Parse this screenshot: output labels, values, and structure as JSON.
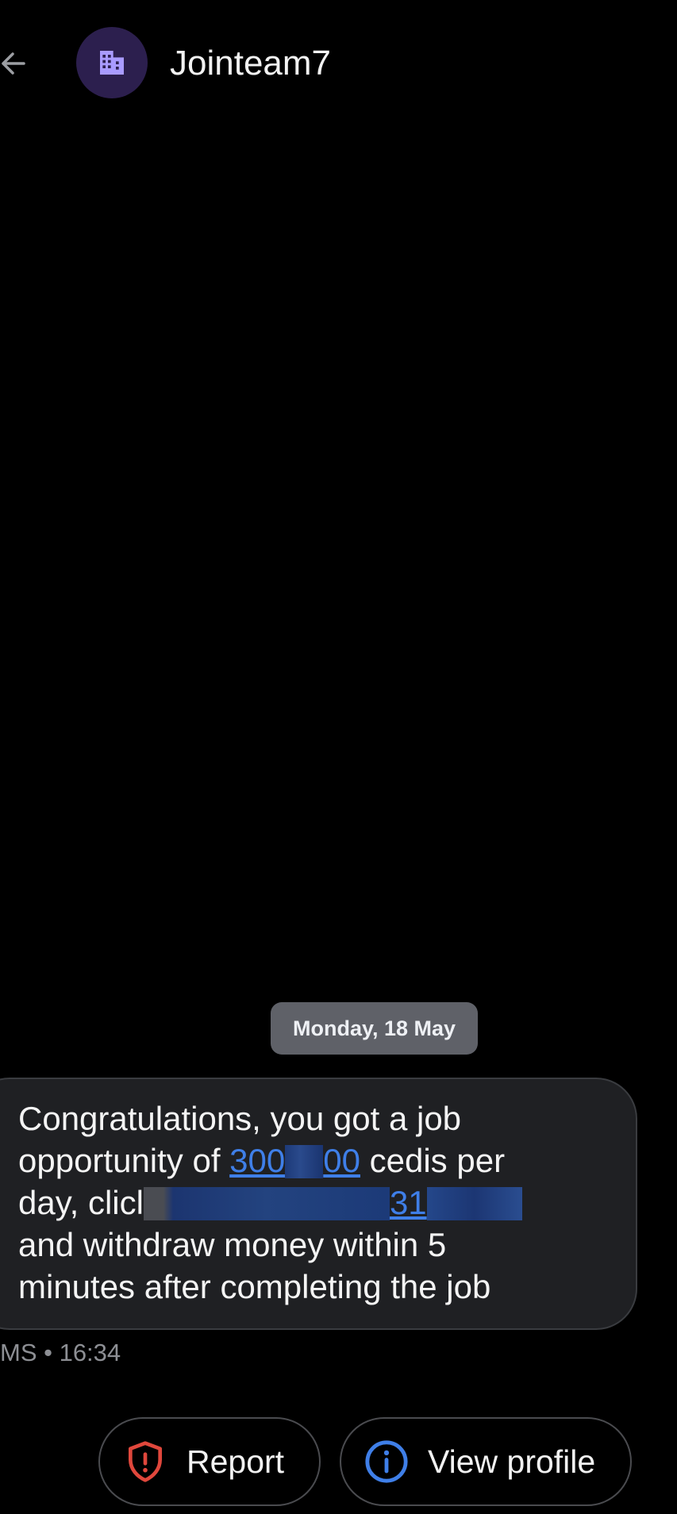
{
  "header": {
    "contact_name": "Jointeam7",
    "back_icon": "arrow-left-icon",
    "avatar_icon": "building-icon",
    "avatar_bg": "#2c1f4e",
    "avatar_icon_color": "#a99bff"
  },
  "conversation": {
    "date_label": "Monday, 18 May",
    "message": {
      "line1": "Congratulations, you got a job",
      "line2_pre": "opportunity of ",
      "link1_a": "300",
      "link1_b": "00",
      "line2_post": " cedis per",
      "line3_pre": "day, clicl",
      "link2_visible": "31",
      "line4": "and withdraw money within 5",
      "line5": "minutes after completing the job"
    },
    "meta": "MS • 16:34"
  },
  "actions": {
    "report_label": "Report",
    "report_icon": "shield-alert-icon",
    "report_color": "#e0473c",
    "profile_label": "View profile",
    "profile_icon": "info-icon",
    "profile_color": "#3f7fe8"
  }
}
